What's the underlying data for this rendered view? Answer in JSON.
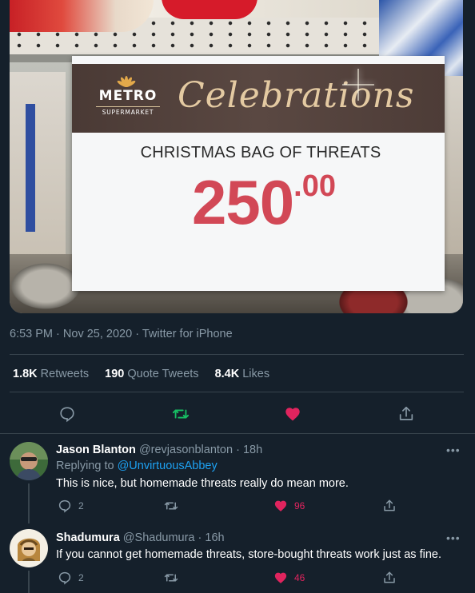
{
  "photo": {
    "sign": {
      "store_name": "METRO",
      "store_subtitle": "SUPERMARKET",
      "script_title": "Celebrations",
      "product_name": "CHRISTMAS BAG OF THREATS",
      "price_main": "250",
      "price_cents": ".00"
    }
  },
  "tweet": {
    "time": "6:53 PM",
    "separator": "·",
    "date": "Nov 25, 2020",
    "client": "Twitter for iPhone",
    "stats": {
      "retweets_count": "1.8K",
      "retweets_label": "Retweets",
      "quote_count": "190",
      "quote_label": "Quote Tweets",
      "likes_count": "8.4K",
      "likes_label": "Likes"
    },
    "actions": [
      "reply-icon",
      "retweet-icon",
      "like-icon",
      "share-icon"
    ]
  },
  "replies": [
    {
      "name": "Jason Blanton",
      "handle": "@revjasonblanton",
      "separator": "·",
      "age": "18h",
      "replying_prefix": "Replying to",
      "replying_to": "@UnvirtuousAbbey",
      "text": "This is nice, but homemade threats really do mean more.",
      "replies": "2",
      "likes": "96",
      "more": "•••"
    },
    {
      "name": "Shadumura",
      "handle": "@Shadumura",
      "separator": "·",
      "age": "16h",
      "text": "If you cannot get homemade threats, store-bought threats work just as fine.",
      "replies": "2",
      "likes": "46",
      "more": "•••"
    }
  ],
  "colors": {
    "background": "#15202b",
    "muted": "#8899a6",
    "divider": "#38444d",
    "link": "#1da1f2",
    "retweet": "#17bf63",
    "like": "#e0245e",
    "price": "#d24856"
  }
}
